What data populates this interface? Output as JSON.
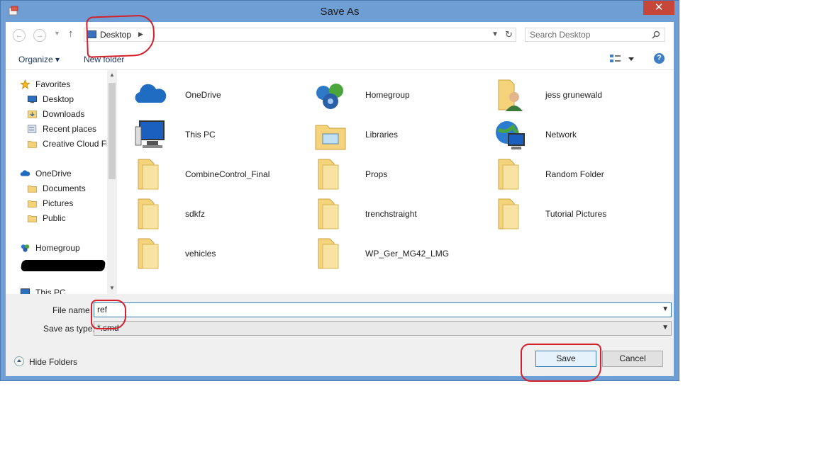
{
  "window": {
    "title": "Save As",
    "close_glyph": "✕",
    "accent_color": "#6f9ed4"
  },
  "address": {
    "location": "Desktop",
    "search_placeholder": "Search Desktop"
  },
  "toolbar": {
    "organize_label": "Organize ▾",
    "new_folder_label": "New folder",
    "help_glyph": "?"
  },
  "nav_pane": {
    "items": [
      {
        "label": "Favorites",
        "icon": "star-icon"
      },
      {
        "label": "Desktop",
        "icon": "desktop-icon"
      },
      {
        "label": "Downloads",
        "icon": "downloads-folder-icon"
      },
      {
        "label": "Recent places",
        "icon": "recent-places-icon"
      },
      {
        "label": "Creative Cloud Fi",
        "icon": "folder-icon"
      },
      {
        "label": "OneDrive",
        "icon": "cloud-icon"
      },
      {
        "label": "Documents",
        "icon": "folder-icon"
      },
      {
        "label": "Pictures",
        "icon": "folder-icon"
      },
      {
        "label": "Public",
        "icon": "folder-icon"
      },
      {
        "label": "Homegroup",
        "icon": "homegroup-icon"
      },
      {
        "label": "This PC",
        "icon": "computer-icon"
      }
    ]
  },
  "content": {
    "items": [
      {
        "label": "OneDrive",
        "icon": "cloud-icon"
      },
      {
        "label": "Homegroup",
        "icon": "homegroup-icon"
      },
      {
        "label": "jess grunewald",
        "icon": "user-folder-icon"
      },
      {
        "label": "This PC",
        "icon": "computer-icon"
      },
      {
        "label": "Libraries",
        "icon": "libraries-icon"
      },
      {
        "label": "Network",
        "icon": "network-icon"
      },
      {
        "label": "CombineControl_Final",
        "icon": "folder-icon"
      },
      {
        "label": "Props",
        "icon": "folder-icon"
      },
      {
        "label": "Random Folder",
        "icon": "folder-icon"
      },
      {
        "label": "sdkfz",
        "icon": "folder-icon"
      },
      {
        "label": "trenchstraight",
        "icon": "folder-icon"
      },
      {
        "label": "Tutorial Pictures",
        "icon": "folder-icon"
      },
      {
        "label": "vehicles",
        "icon": "folder-icon"
      },
      {
        "label": "WP_Ger_MG42_LMG",
        "icon": "folder-icon"
      }
    ]
  },
  "form": {
    "file_name_label": "File name:",
    "file_name_value": "ref",
    "save_type_label": "Save as type:",
    "save_type_value": "*.smd"
  },
  "footer": {
    "hide_folders_label": "Hide Folders",
    "save_label": "Save",
    "cancel_label": "Cancel"
  }
}
